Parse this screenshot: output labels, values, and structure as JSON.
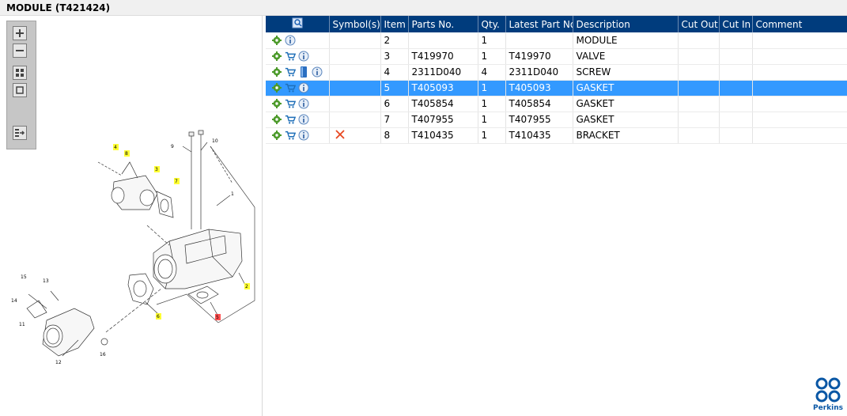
{
  "window": {
    "title": "MODULE (T421424)"
  },
  "toolbar": {
    "zoom_in": "zoom-in-icon",
    "zoom_out": "zoom-out-icon",
    "fit": "fit-window-icon",
    "actual": "actual-size-icon",
    "export": "export-icon"
  },
  "drawing": {
    "callouts": [
      "1",
      "2",
      "3",
      "4",
      "5",
      "6",
      "7",
      "8",
      "9",
      "10",
      "11",
      "12",
      "13",
      "14",
      "15",
      "16"
    ],
    "colors": {
      "callout_fill": "#ffff33",
      "callout_selected": "#ff5050"
    }
  },
  "grid": {
    "columns": [
      "",
      "Symbol(s)",
      "Item",
      "Parts No.",
      "Qty.",
      "Latest Part No.",
      "Description",
      "Cut Out",
      "Cut In",
      "Comment"
    ],
    "rows": [
      {
        "icons": [
          "gear",
          "info"
        ],
        "symbol": "",
        "item": "2",
        "part_no": "",
        "qty": "1",
        "latest": "",
        "desc": "MODULE",
        "selected": false
      },
      {
        "icons": [
          "gear",
          "cart",
          "info"
        ],
        "symbol": "",
        "item": "3",
        "part_no": "T419970",
        "qty": "1",
        "latest": "T419970",
        "desc": "VALVE",
        "selected": false
      },
      {
        "icons": [
          "gear",
          "cart",
          "book",
          "info"
        ],
        "symbol": "",
        "item": "4",
        "part_no": "2311D040",
        "qty": "4",
        "latest": "2311D040",
        "desc": "SCREW",
        "selected": false
      },
      {
        "icons": [
          "gear",
          "cart",
          "info"
        ],
        "symbol": "",
        "item": "5",
        "part_no": "T405093",
        "qty": "1",
        "latest": "T405093",
        "desc": "GASKET",
        "selected": true
      },
      {
        "icons": [
          "gear",
          "cart",
          "info"
        ],
        "symbol": "",
        "item": "6",
        "part_no": "T405854",
        "qty": "1",
        "latest": "T405854",
        "desc": "GASKET",
        "selected": false
      },
      {
        "icons": [
          "gear",
          "cart",
          "info"
        ],
        "symbol": "",
        "item": "7",
        "part_no": "T407955",
        "qty": "1",
        "latest": "T407955",
        "desc": "GASKET",
        "selected": false
      },
      {
        "icons": [
          "gear",
          "cart",
          "info"
        ],
        "symbol": "cross",
        "item": "8",
        "part_no": "T410435",
        "qty": "1",
        "latest": "T410435",
        "desc": "BRACKET",
        "selected": false
      }
    ],
    "colors": {
      "header_bg": "#003c7d",
      "selected_bg": "#3399ff"
    }
  },
  "brand": {
    "logo_text": "Perkins"
  }
}
